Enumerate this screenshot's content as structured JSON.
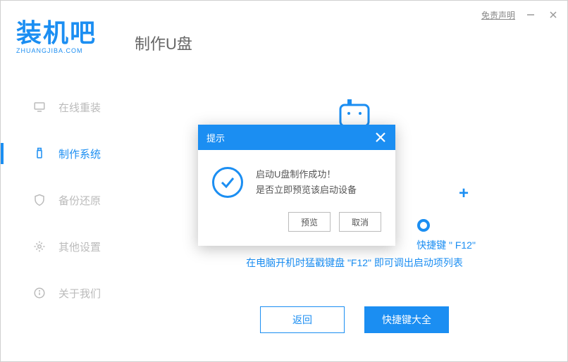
{
  "titlebar": {
    "disclaimer": "免责声明"
  },
  "logo": {
    "text": "装机吧",
    "sub": "ZHUANGJIBA.COM"
  },
  "page_title": "制作U盘",
  "sidebar": {
    "items": [
      {
        "label": "在线重装"
      },
      {
        "label": "制作系统"
      },
      {
        "label": "备份还原"
      },
      {
        "label": "其他设置"
      },
      {
        "label": "关于我们"
      }
    ],
    "active_index": 1
  },
  "hint": {
    "line1": "快捷键 \" F12\"",
    "line2": "在电脑开机时猛戳键盘 \"F12\" 即可调出启动项列表"
  },
  "buttons": {
    "back": "返回",
    "shortcuts": "快捷键大全"
  },
  "dialog": {
    "title": "提示",
    "message_line1": "启动U盘制作成功！",
    "message_line2": "是否立即预览该启动设备",
    "preview": "预览",
    "cancel": "取消"
  }
}
